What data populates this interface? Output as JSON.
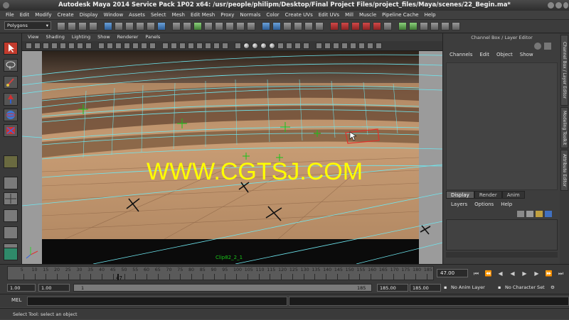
{
  "window": {
    "title": "Autodesk Maya 2014 Service Pack 1P02 x64: /usr/people/philipm/Desktop/Final Project Files/project_files/Maya/scenes/22_Begin.ma*"
  },
  "menubar": [
    "File",
    "Edit",
    "Modify",
    "Create",
    "Display",
    "Window",
    "Assets",
    "Select",
    "Mesh",
    "Edit Mesh",
    "Proxy",
    "Normals",
    "Color",
    "Create UVs",
    "Edit UVs",
    "Mill",
    "Muscle",
    "Pipeline Cache",
    "Help"
  ],
  "shelf": {
    "mode_selector": "Polygons"
  },
  "viewport": {
    "panel_menu": [
      "View",
      "Shading",
      "Lighting",
      "Show",
      "Renderer",
      "Panels"
    ],
    "watermark": "WWW.CGTSJ.COM",
    "clip_label": "Clip82_2_1",
    "axis": {
      "x": "x",
      "y": "y",
      "z": "z"
    }
  },
  "channel_box": {
    "title": "Channel Box / Layer Editor",
    "menu": [
      "Channels",
      "Edit",
      "Object",
      "Show"
    ]
  },
  "layer_editor": {
    "tabs": [
      "Display",
      "Render",
      "Anim"
    ],
    "active_tab": "Display",
    "menu": [
      "Layers",
      "Options",
      "Help"
    ]
  },
  "side_tabs": [
    "Channel Box / Layer Editor",
    "Modeling Toolkit",
    "Attribute Editor"
  ],
  "time_slider": {
    "ticks": [
      "5",
      "10",
      "15",
      "20",
      "25",
      "30",
      "35",
      "40",
      "45",
      "50",
      "55",
      "60",
      "65",
      "70",
      "75",
      "80",
      "85",
      "90",
      "95",
      "100",
      "105",
      "110",
      "115",
      "120",
      "125",
      "130",
      "135",
      "140",
      "145",
      "150",
      "155",
      "160",
      "165",
      "170",
      "175",
      "180",
      "185"
    ],
    "current_frame_marker": "47",
    "current_frame": "47.00"
  },
  "range_slider": {
    "start_time": "1.00",
    "playback_start": "1.00",
    "range_start_label": "1",
    "range_end_label": "185",
    "playback_end": "185.00",
    "end_time": "185.00",
    "anim_layer": "No Anim Layer",
    "character_set": "No Character Set"
  },
  "command_line": {
    "label": "MEL"
  },
  "help_line": "Select Tool: select an object",
  "colors": {
    "watermark": "#ffff00",
    "wireframe": "#6ee7f0",
    "selection": "#e0302a",
    "locator": "#18c418"
  }
}
